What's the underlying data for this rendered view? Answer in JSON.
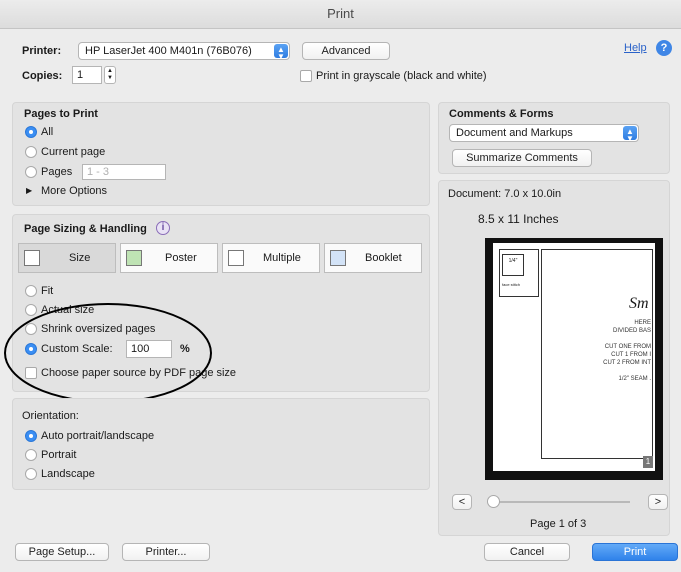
{
  "window": {
    "title": "Print"
  },
  "header": {
    "printer_label": "Printer:",
    "printer_value": "HP LaserJet 400 M401n (76B076)",
    "advanced_label": "Advanced",
    "help_label": "Help",
    "copies_label": "Copies:",
    "copies_value": "1",
    "grayscale_label": "Print in grayscale (black and white)"
  },
  "pages_to_print": {
    "title": "Pages to Print",
    "all": "All",
    "current_page": "Current page",
    "pages": "Pages",
    "pages_placeholder": "1 - 3",
    "more_options": "More Options"
  },
  "page_sizing": {
    "title": "Page Sizing & Handling",
    "tabs": [
      "Size",
      "Poster",
      "Multiple",
      "Booklet"
    ],
    "fit": "Fit",
    "actual_size": "Actual size",
    "shrink": "Shrink oversized pages",
    "custom_scale": "Custom Scale:",
    "custom_scale_value": "100",
    "percent": "%",
    "paper_source": "Choose paper source by PDF page size"
  },
  "orientation": {
    "title": "Orientation:",
    "auto": "Auto portrait/landscape",
    "portrait": "Portrait",
    "landscape": "Landscape"
  },
  "comments_forms": {
    "title": "Comments & Forms",
    "value": "Document and Markups",
    "summarize": "Summarize Comments"
  },
  "preview": {
    "document_size": "Document: 7.0 x 10.0in",
    "paper_size": "8.5 x 11 Inches",
    "page_indicator": "Page 1 of 3",
    "prev": "<",
    "next": ">",
    "page_text": {
      "box1": "1/4\"",
      "box2": "face stitch",
      "brand": "Sm",
      "lines": [
        "HERE",
        "DIVIDED BAS",
        "CUT ONE FROM",
        "CUT 1 FROM I",
        "CUT 2 FROM INT",
        "1/2\" SEAM ."
      ],
      "page_number": "1"
    }
  },
  "footer": {
    "page_setup": "Page Setup...",
    "printer": "Printer...",
    "cancel": "Cancel",
    "print": "Print"
  },
  "colors": {
    "accent": "#3a8ef3",
    "help_link": "#2a62c9",
    "annotation_stroke": "#000000"
  }
}
